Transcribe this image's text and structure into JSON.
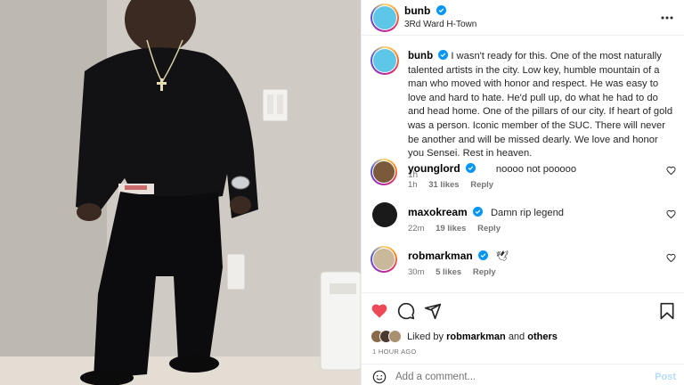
{
  "post": {
    "author": "bunb",
    "location": "3Rd Ward H-Town",
    "more_icon": "more-horizontal-icon"
  },
  "caption": {
    "author": "bunb",
    "text": "I wasn't ready for this. One of the most naturally talented artists in the city. Low key, humble mountain of a man who moved with honor and respect. He was easy to love and hard to hate. He'd pull up, do what he had to do and head home. One of the pillars of our city. If heart of gold was a person. Iconic member of the SUC. There will never be another and will be missed dearly. We love and honor you Sensei. Rest in heaven.",
    "time": "1h"
  },
  "comments": [
    {
      "user": "younglord",
      "text": "noooo not pooooo",
      "time": "1h",
      "likes": "31 likes",
      "reply": "Reply"
    },
    {
      "user": "maxokream",
      "text": "Damn rip legend",
      "time": "22m",
      "likes": "19 likes",
      "reply": "Reply"
    },
    {
      "user": "robmarkman",
      "text": "🕊",
      "time": "30m",
      "likes": "5 likes",
      "reply": "Reply"
    }
  ],
  "liked": {
    "prefix": "Liked by",
    "user": "robmarkman",
    "and": "and",
    "others": "others"
  },
  "timestamp": "1 HOUR AGO",
  "add_comment": {
    "placeholder": "Add a comment...",
    "post_label": "Post"
  },
  "colors": {
    "verified": "#0095f6",
    "like_active": "#ed4956",
    "post_button_disabled": "#b3dbff"
  }
}
